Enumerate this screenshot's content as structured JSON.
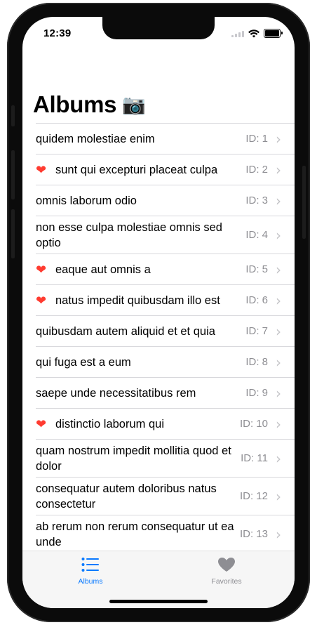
{
  "status_bar": {
    "time": "12:39"
  },
  "page": {
    "title": "Albums",
    "title_icon": "📷"
  },
  "albums": [
    {
      "name": "quidem molestiae enim",
      "id_label": "ID: 1",
      "favorite": false
    },
    {
      "name": "sunt qui excepturi placeat culpa",
      "id_label": "ID: 2",
      "favorite": true
    },
    {
      "name": "omnis laborum odio",
      "id_label": "ID: 3",
      "favorite": false
    },
    {
      "name": "non esse culpa molestiae omnis sed optio",
      "id_label": "ID: 4",
      "favorite": false
    },
    {
      "name": "eaque aut omnis a",
      "id_label": "ID: 5",
      "favorite": true
    },
    {
      "name": "natus impedit quibusdam illo est",
      "id_label": "ID: 6",
      "favorite": true
    },
    {
      "name": "quibusdam autem aliquid et et quia",
      "id_label": "ID: 7",
      "favorite": false
    },
    {
      "name": "qui fuga est a eum",
      "id_label": "ID: 8",
      "favorite": false
    },
    {
      "name": "saepe unde necessitatibus rem",
      "id_label": "ID: 9",
      "favorite": false
    },
    {
      "name": "distinctio laborum qui",
      "id_label": "ID: 10",
      "favorite": true
    },
    {
      "name": "quam nostrum impedit mollitia quod et dolor",
      "id_label": "ID: 11",
      "favorite": false
    },
    {
      "name": "consequatur autem doloribus natus consectetur",
      "id_label": "ID: 12",
      "favorite": false
    },
    {
      "name": "ab rerum non rerum consequatur ut ea unde",
      "id_label": "ID: 13",
      "favorite": false
    }
  ],
  "tab_bar": {
    "albums_label": "Albums",
    "favorites_label": "Favorites",
    "active_tab": "Albums"
  },
  "icons": {
    "favorite": "heart-icon",
    "disclosure": "chevron-right-icon",
    "albums_tab": "list-bullet-icon",
    "favorites_tab": "heart-fill-icon"
  },
  "colors": {
    "accent": "#0a7aff",
    "favorite_heart": "#ff3b30",
    "inactive_tab": "#8e8e93"
  }
}
